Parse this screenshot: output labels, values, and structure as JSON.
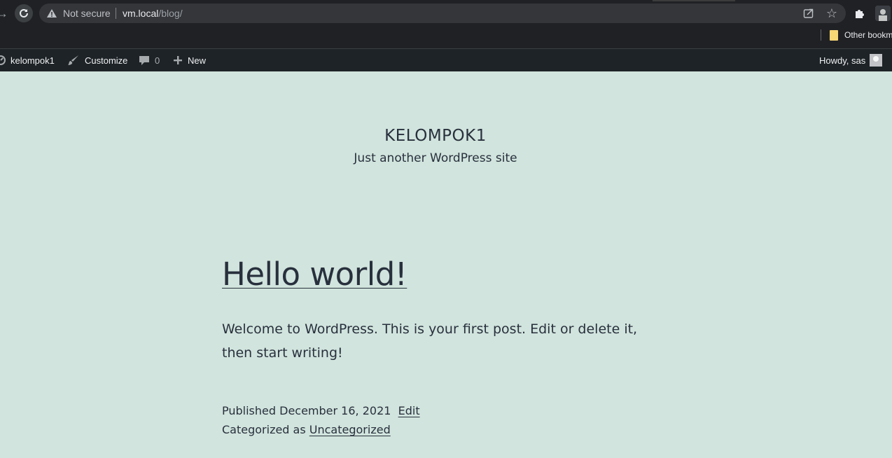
{
  "browser": {
    "security_label": "Not secure",
    "url_host": "vm.local",
    "url_path": "/blog/",
    "bookmarks_label": "Other bookm"
  },
  "adminbar": {
    "site_name": "kelompok1",
    "customize_label": "Customize",
    "comments_count": "0",
    "new_label": "New",
    "howdy_label": "Howdy, sas"
  },
  "site": {
    "title": "KELOMPOK1",
    "description": "Just another WordPress site"
  },
  "post": {
    "title": "Hello world!",
    "content": "Welcome to WordPress. This is your first post. Edit or delete it, then start writing!",
    "published_prefix": "Published",
    "published_date": "December 16, 2021",
    "edit_label": "Edit",
    "categorized_prefix": "Categorized as",
    "category": "Uncategorized"
  },
  "colors": {
    "page_background": "#d1e4dd",
    "text": "#28303d",
    "adminbar_background": "#1d2327",
    "chrome_background": "#202124"
  }
}
